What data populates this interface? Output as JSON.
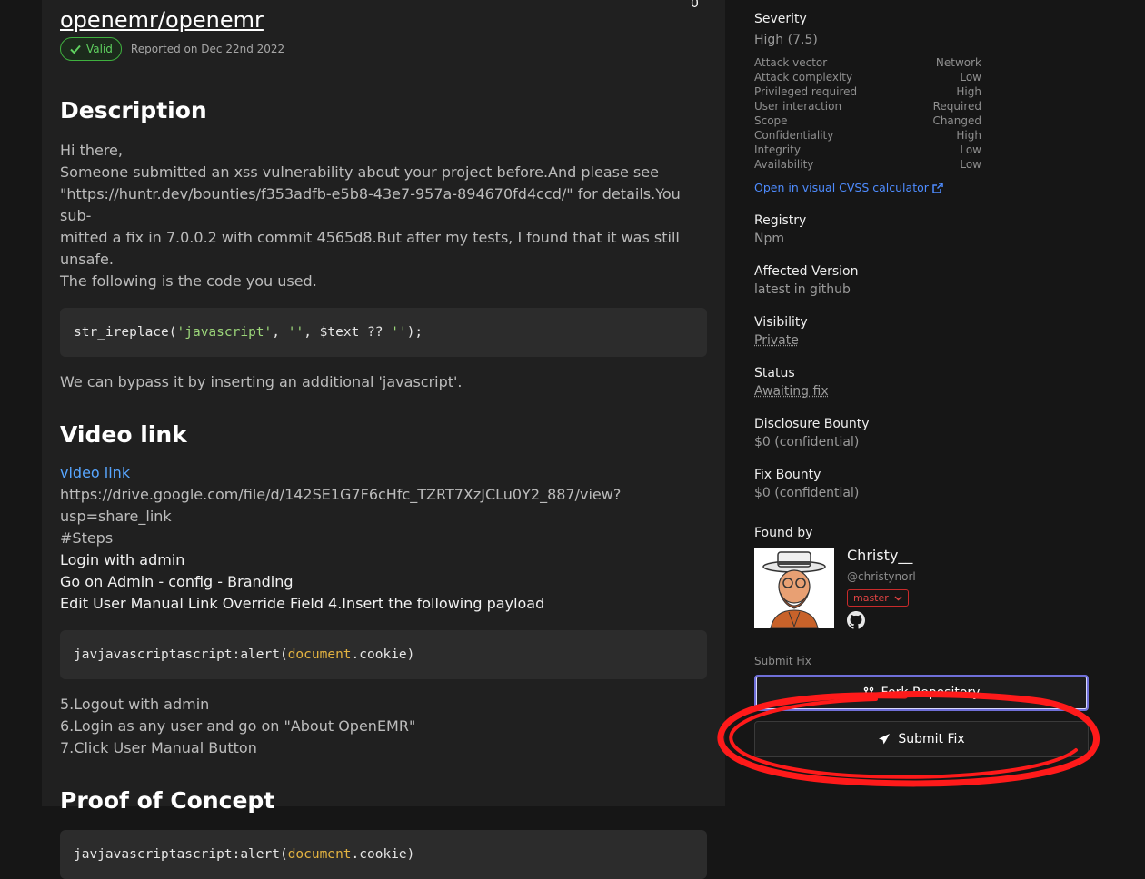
{
  "report": {
    "repo": "openemr/openemr",
    "corner_count": "0",
    "badge": "Valid",
    "reported": "Reported on Dec 22nd 2022"
  },
  "description": {
    "heading": "Description",
    "greeting": "Hi there,",
    "line1": "Someone submitted an xss vulnerability about your project before.And please see",
    "line2": "\"https://huntr.dev/bounties/f353adfb-e5b8-43e7-957a-894670fd4ccd/\" for details.You sub-",
    "line3": "mitted a fix in 7.0.0.2 with commit 4565d8.But after my tests, I found that it was still unsafe.",
    "line4": "The following is the code you used.",
    "code_fn": "str_ireplace(",
    "code_arg1": "'javascript'",
    "code_sep1": ", ",
    "code_arg2": "''",
    "code_mid": ", $text ?? ",
    "code_arg3": "''",
    "code_end": ");",
    "bypass": "We can bypass it by inserting an additional 'javascript'."
  },
  "video": {
    "heading": "Video link",
    "link_text": "video link",
    "url": "https://drive.google.com/file/d/142SE1G7F6cHfc_TZRT7XzJCLu0Y2_887/view?usp=share_link",
    "steps_label": "#Steps",
    "step1": "Login with admin",
    "step2": "Go on Admin - config - Branding",
    "step3": "Edit User Manual Link Override Field 4.Insert the following payload",
    "code_pre": "javjavascriptascript:alert(",
    "code_obj": "document",
    "code_post": ".cookie)",
    "step5": "5.Logout with admin",
    "step6": "6.Login as any user and go on \"About OpenEMR\"",
    "step7": "7.Click User Manual Button"
  },
  "poc": {
    "heading": "Proof of Concept",
    "code_pre": "javjavascriptascript:alert(",
    "code_obj": "document",
    "code_post": ".cookie)"
  },
  "sidebar": {
    "severity_label": "Severity",
    "severity_value": "High (7.5)",
    "metrics": [
      {
        "name": "Attack vector",
        "value": "Network"
      },
      {
        "name": "Attack complexity",
        "value": "Low"
      },
      {
        "name": "Privileged required",
        "value": "High"
      },
      {
        "name": "User interaction",
        "value": "Required"
      },
      {
        "name": "Scope",
        "value": "Changed"
      },
      {
        "name": "Confidentiality",
        "value": "High"
      },
      {
        "name": "Integrity",
        "value": "Low"
      },
      {
        "name": "Availability",
        "value": "Low"
      }
    ],
    "cvss_link": "Open in visual CVSS calculator",
    "registry_label": "Registry",
    "registry_value": "Npm",
    "version_label": "Affected Version",
    "version_value": "latest in github",
    "visibility_label": "Visibility",
    "visibility_value": "Private",
    "status_label": "Status",
    "status_value": "Awaiting fix",
    "disclosure_label": "Disclosure Bounty",
    "disclosure_value": "$0 (confidential)",
    "fix_bounty_label": "Fix Bounty",
    "fix_bounty_value": "$0 (confidential)",
    "found_by_label": "Found by",
    "finder_name": "Christy__",
    "finder_handle": "@christynorl",
    "finder_badge": "master",
    "submit_section_label": "Submit Fix",
    "fork_button": "Fork Repository",
    "submit_button": "Submit Fix"
  },
  "colors": {
    "accent_blue": "#4e8cff",
    "valid_green": "#3fb13f",
    "annotation_red": "#ff1a1a"
  }
}
